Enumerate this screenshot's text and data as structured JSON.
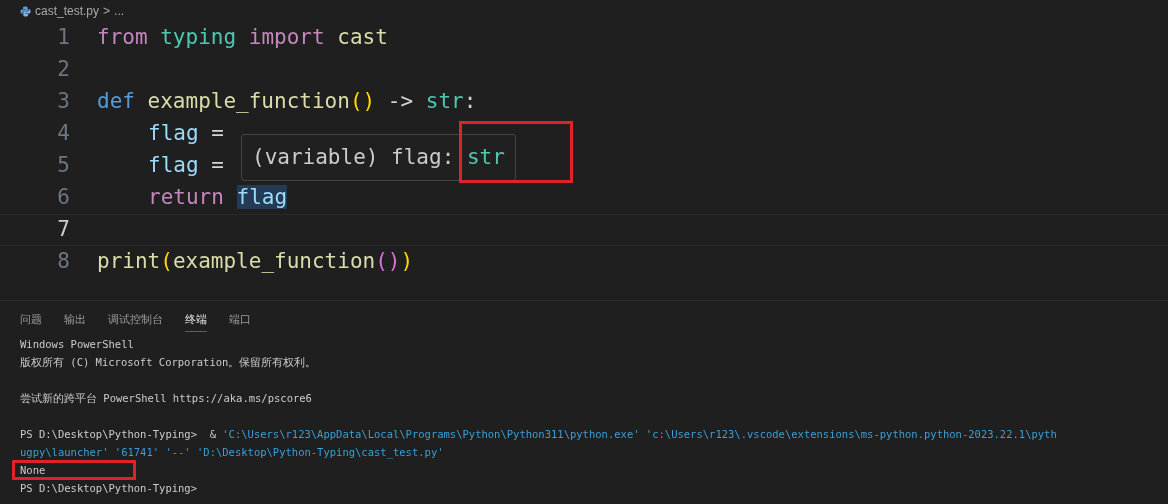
{
  "breadcrumb": {
    "file": "cast_test.py",
    "separator": ">",
    "rest": "..."
  },
  "editor": {
    "lines": [
      {
        "number": "1",
        "current": false,
        "tokens": [
          {
            "text": "from ",
            "kind": "keyword"
          },
          {
            "text": "typing ",
            "kind": "type"
          },
          {
            "text": "import ",
            "kind": "keyword"
          },
          {
            "text": "cast",
            "kind": "function"
          }
        ]
      },
      {
        "number": "2",
        "current": false
      },
      {
        "number": "3",
        "current": false,
        "tokens": [
          {
            "text": "def ",
            "kind": "storage"
          },
          {
            "text": "example_function",
            "kind": "function"
          },
          {
            "text": "()",
            "kind": "bracket1"
          },
          {
            "text": " -> ",
            "kind": "plain"
          },
          {
            "text": "str",
            "kind": "type"
          },
          {
            "text": ":",
            "kind": "plain"
          }
        ],
        "children": [
          {
            "number": "4",
            "current": false,
            "tokens": [
              {
                "text": "flag",
                "kind": "variable"
              },
              {
                "text": " =",
                "kind": "plain"
              }
            ]
          },
          {
            "number": "5",
            "current": false,
            "tokens": [
              {
                "text": "flag",
                "kind": "variable"
              },
              {
                "text": " =",
                "kind": "plain"
              }
            ]
          },
          {
            "number": "6",
            "current": false,
            "tokens": [
              {
                "text": "return ",
                "kind": "keyword"
              },
              {
                "text": "flag",
                "kind": "variable",
                "highlighted": true
              }
            ]
          }
        ]
      },
      {
        "number": "7",
        "current": true
      },
      {
        "number": "8",
        "current": false,
        "tokens": [
          {
            "text": "print",
            "kind": "function"
          },
          {
            "text": "(",
            "kind": "bracket1"
          },
          {
            "text": "example_function",
            "kind": "function"
          },
          {
            "text": "()",
            "kind": "bracket2"
          },
          {
            "text": ")",
            "kind": "bracket1"
          }
        ]
      }
    ],
    "hover": {
      "label": "(variable) flag: ",
      "type": "str"
    }
  },
  "panel": {
    "tabs": [
      {
        "label": "问题",
        "selected": false
      },
      {
        "label": "输出",
        "selected": false
      },
      {
        "label": "调试控制台",
        "selected": false
      },
      {
        "label": "终端",
        "selected": true
      },
      {
        "label": "端口",
        "selected": false
      }
    ],
    "terminal": [
      [
        {
          "text": "Windows PowerShell",
          "kind": "plain"
        }
      ],
      [
        {
          "text": "版权所有 (C) Microsoft Corporation。保留所有权利。",
          "kind": "plain"
        }
      ],
      [
        {
          "text": "尝试新的跨平台 PowerShell https://aka.ms/pscore6",
          "kind": "plain"
        }
      ],
      [
        {
          "text": "PS D:\\Desktop\\Python-Typing>  & ",
          "kind": "plain"
        },
        {
          "text": "'C:\\Users\\r123\\AppData\\Local\\Programs\\Python\\Python311\\python.exe' 'c:\\Users\\r123\\.vscode\\extensions\\ms-python.python-2023.22.1\\pyth",
          "kind": "string"
        }
      ],
      [
        {
          "text": "ugpy\\launcher' '61741' '--' 'D:\\Desktop\\Python-Typing\\cast_test.py'",
          "kind": "string"
        }
      ],
      [
        {
          "text": "None",
          "kind": "plain"
        }
      ],
      [
        {
          "text": "PS D:\\Desktop\\Python-Typing>",
          "kind": "plain"
        }
      ]
    ]
  }
}
